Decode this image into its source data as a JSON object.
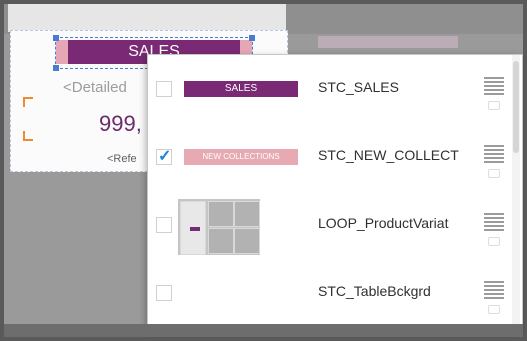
{
  "canvas": {
    "sales_label": "SALES",
    "detailed_text": "<Detailed",
    "price_text": "999,",
    "reference_text": "<Refe"
  },
  "panel": {
    "rows": [
      {
        "checked": false,
        "thumbnail_label": "SALES",
        "name": "STC_SALES"
      },
      {
        "checked": true,
        "thumbnail_label": "NEW COLLECTIONS",
        "name": "STC_NEW_COLLECT"
      },
      {
        "checked": false,
        "thumbnail_label": "",
        "name": "LOOP_ProductVariat"
      },
      {
        "checked": false,
        "thumbnail_label": "",
        "name": "STC_TableBckgrd"
      }
    ]
  },
  "colors": {
    "sales_purple": "#7a2a74",
    "collection_pink": "#e7a9b2",
    "price_purple": "#6b2a6a",
    "selection_blue": "#4a7bd0"
  }
}
